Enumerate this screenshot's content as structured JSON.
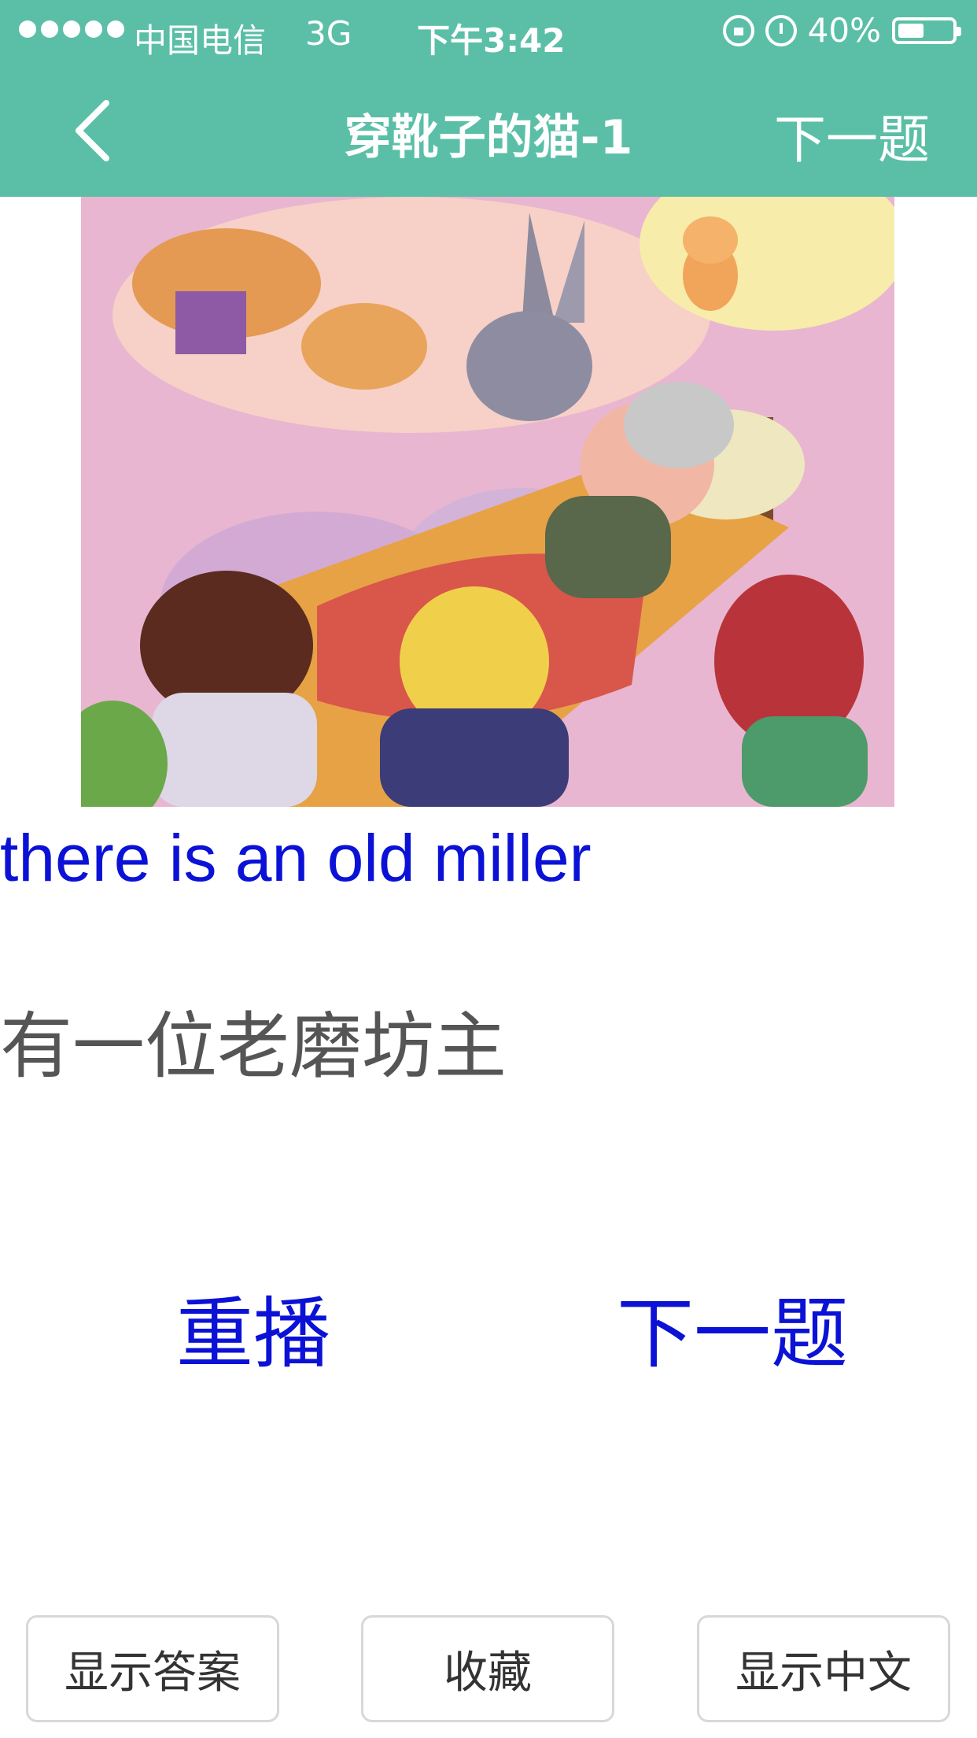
{
  "status_bar": {
    "carrier": "中国电信",
    "network": "3G",
    "time": "下午3:42",
    "battery": "40%",
    "battery_level": 0.4
  },
  "nav": {
    "title": "穿靴子的猫-1",
    "next_label": "下一题"
  },
  "content": {
    "english": "there is an old miller",
    "chinese": "有一位老磨坊主"
  },
  "actions": {
    "replay_label": "重播",
    "next_label": "下一题"
  },
  "bottom": {
    "show_answer": "显示答案",
    "favorite": "收藏",
    "show_chinese": "显示中文"
  },
  "colors": {
    "header": "#5bbfa7",
    "accent_text": "#0b12d6"
  }
}
